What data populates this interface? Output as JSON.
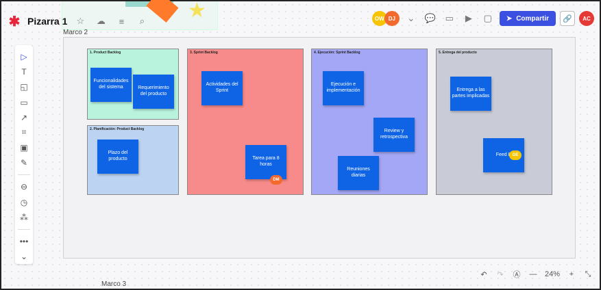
{
  "app": {
    "title": "Pizarra 1"
  },
  "frames": {
    "marco2": "Marco 2",
    "marco3": "Marco 3"
  },
  "header": {
    "avatars": [
      {
        "initials": "OW",
        "color": "#f6c400"
      },
      {
        "initials": "DJ",
        "color": "#f26a2e"
      }
    ],
    "share_label": "Compartir",
    "user_initials": "AC",
    "user_color": "#e53935"
  },
  "board": {
    "columns": [
      {
        "title": "1. Product Backlog",
        "color": "#b9f3dd",
        "notes": [
          "Funcionalidades del sistema",
          "Requerimiento del producto"
        ]
      },
      {
        "title": "2. Planificación: Product Backlog",
        "color": "#bcd3f2",
        "notes": [
          "Plazo del producto"
        ]
      },
      {
        "title": "3. Sprint Backlog",
        "color": "#f78b8b",
        "notes": [
          "Actividades del Sprint",
          "Tarea para 8 horas"
        ]
      },
      {
        "title": "4. Ejecución: Sprint Backlog",
        "color": "#a4a7f5",
        "notes": [
          "Ejecución e implementación",
          "Review y retrospectiva",
          "Reuniones diarias"
        ]
      },
      {
        "title": "5. Entrega del producto",
        "color": "#c9ccd6",
        "notes": [
          "Entrega a las partes implicadas",
          "Feed B"
        ]
      }
    ],
    "cursors": [
      {
        "label": "DM",
        "color": "#f26a2e"
      },
      {
        "label": "OE",
        "color": "#f6c400"
      }
    ]
  },
  "zoom": {
    "level": "24%"
  }
}
